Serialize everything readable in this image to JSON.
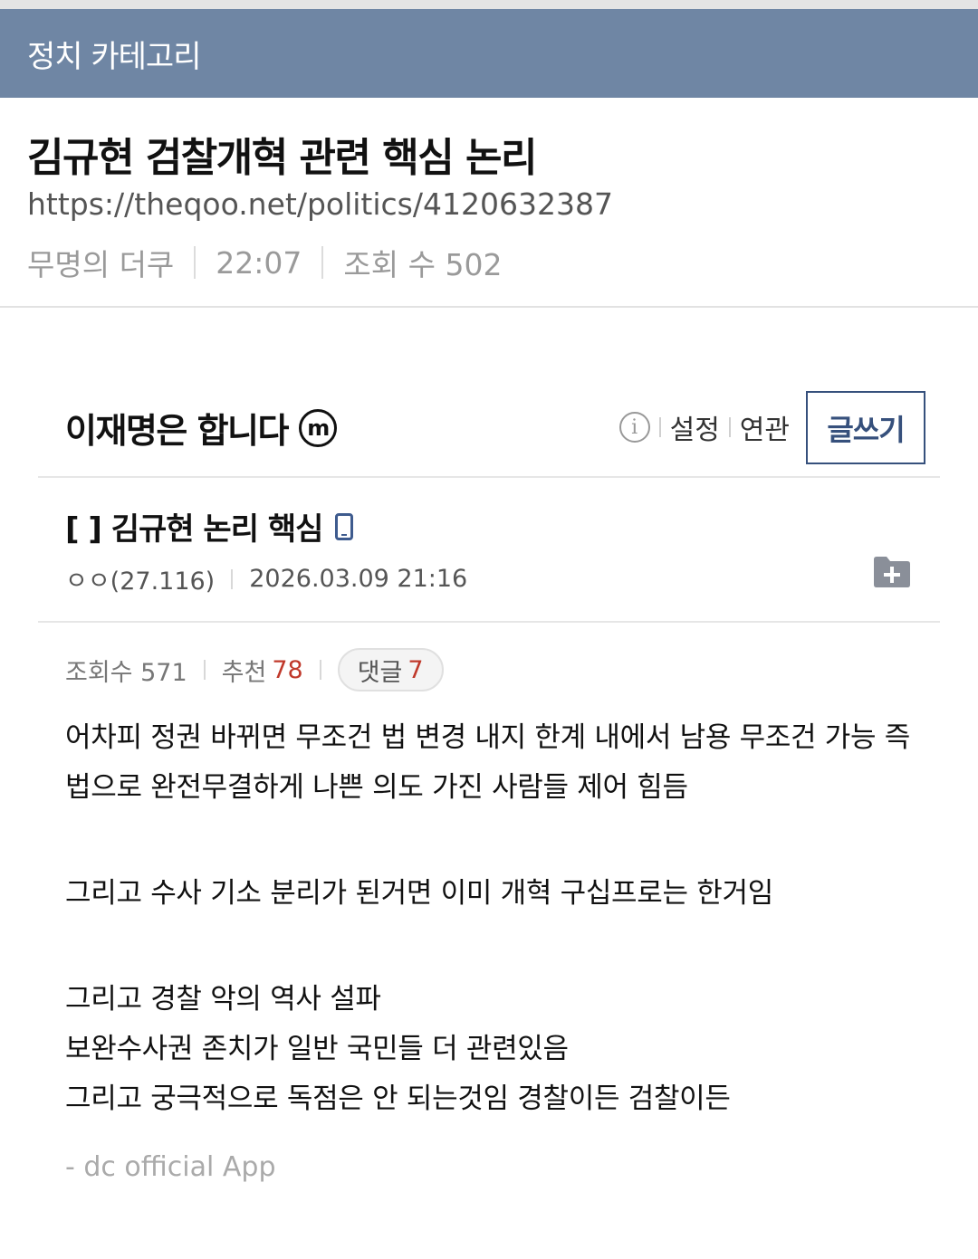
{
  "category_bar": {
    "title": "정치 카테고리"
  },
  "post": {
    "title": "김규현 검찰개혁 관련 핵심 논리",
    "url": "https://theqoo.net/politics/4120632387",
    "author": "무명의 더쿠",
    "time": "22:07",
    "views_label": "조회 수 502"
  },
  "gallery": {
    "name": "이재명은 합니다",
    "badge": "m",
    "info_icon": "info-icon",
    "settings_label": "설정",
    "related_label": "연관",
    "write_label": "글쓰기"
  },
  "article": {
    "title": "[  ] 김규현 논리 핵심",
    "author": "ㅇㅇ(27.116)",
    "datetime": "2026.03.09 21:16",
    "views_label": "조회수 571",
    "recommend_label": "추천",
    "recommend_count": "78",
    "comments_label": "댓글",
    "comments_count": "7",
    "body": [
      "어차피 정권 바뀌면 무조건 법 변경 내지 한계 내에서 남용 무조건 가능 즉 법으로 완전무결하게 나쁜 의도 가진 사람들 제어 힘듬",
      "그리고 수사 기소 분리가 된거면 이미 개혁 구십프로는 한거임",
      "그리고 경찰 악의 역사 설파",
      "보완수사권 존치가 일반 국민들 더 관련있음",
      "그리고 궁극적으로 독점은 안 되는것임  경찰이든 검찰이든"
    ],
    "signature": "- dc official App"
  },
  "colors": {
    "category_bar": "#6f86a4",
    "accent_red": "#c0392b",
    "write_button": "#36507c"
  }
}
